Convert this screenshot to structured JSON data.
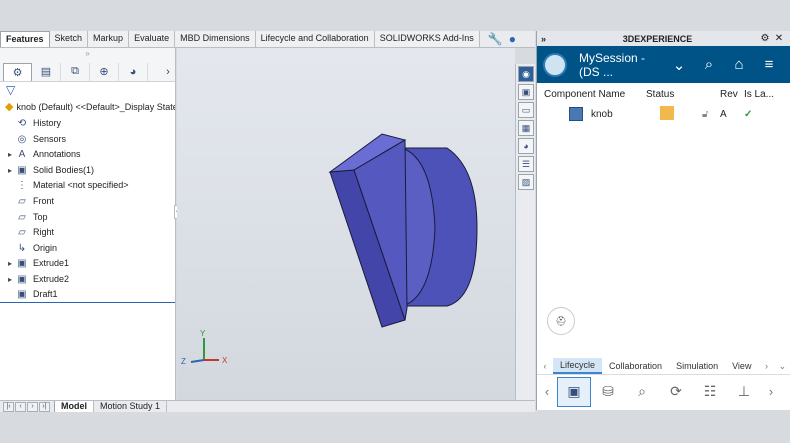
{
  "cmd_tabs": [
    "Features",
    "Sketch",
    "Markup",
    "Evaluate",
    "MBD Dimensions",
    "Lifecycle and Collaboration",
    "SOLIDWORKS Add-Ins"
  ],
  "fm_toolbar_icons": [
    "feature-manager-icon",
    "property-manager-icon",
    "configuration-manager-icon",
    "dimxpert-icon",
    "display-manager-icon"
  ],
  "tree": {
    "root_label": "knob (Default) <<Default>_Display State",
    "items": [
      {
        "label": "History",
        "icon": "history-icon",
        "expand": false
      },
      {
        "label": "Sensors",
        "icon": "sensors-icon",
        "expand": false
      },
      {
        "label": "Annotations",
        "icon": "annotations-icon",
        "expand": true
      },
      {
        "label": "Solid Bodies(1)",
        "icon": "solid-bodies-icon",
        "expand": true
      },
      {
        "label": "Material <not specified>",
        "icon": "material-icon",
        "expand": false
      },
      {
        "label": "Front",
        "icon": "plane-icon",
        "expand": false
      },
      {
        "label": "Top",
        "icon": "plane-icon",
        "expand": false
      },
      {
        "label": "Right",
        "icon": "plane-icon",
        "expand": false
      },
      {
        "label": "Origin",
        "icon": "origin-icon",
        "expand": false
      },
      {
        "label": "Extrude1",
        "icon": "extrude-icon",
        "expand": true
      },
      {
        "label": "Extrude2",
        "icon": "extrude-icon",
        "expand": true
      },
      {
        "label": "Draft1",
        "icon": "draft-icon",
        "expand": false
      }
    ]
  },
  "bottom_tabs": [
    "Model",
    "Motion Study 1"
  ],
  "axes": {
    "x": "X",
    "y": "Y",
    "z": "Z"
  },
  "xp": {
    "title": "3DEXPERIENCE",
    "session": "MySession - (DS ...",
    "columns": [
      "Component Name",
      "Status",
      "Rev",
      "Is La..."
    ],
    "row": {
      "name": "knob",
      "rev": "A",
      "is_latest": "✓"
    },
    "tabs": [
      "Lifecycle",
      "Collaboration",
      "Simulation",
      "View"
    ]
  },
  "colors": {
    "brand_bar": "#005386",
    "model_face": "#5b5fc4",
    "model_side": "#4346a8"
  }
}
